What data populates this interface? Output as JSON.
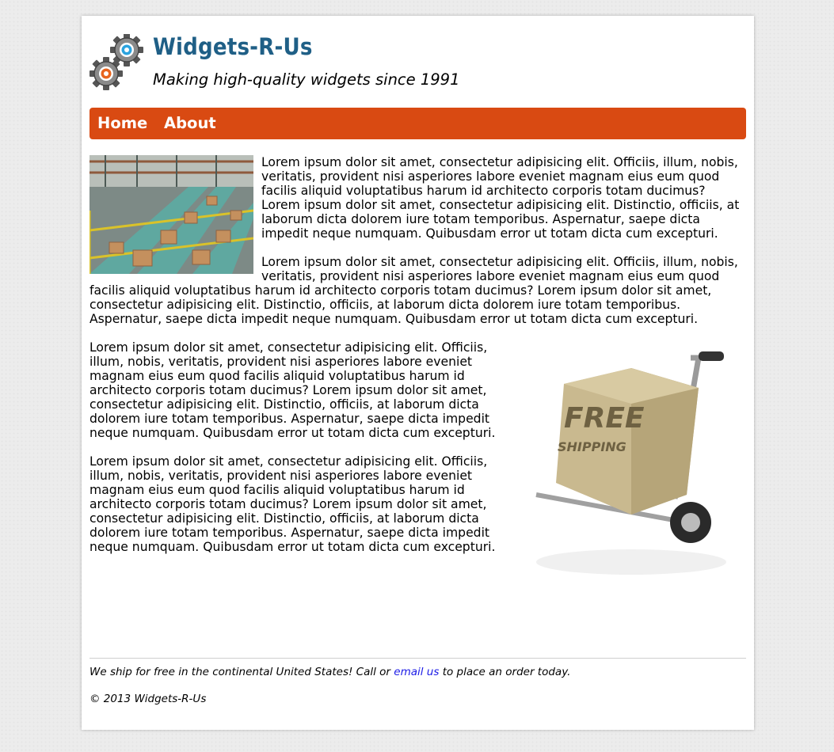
{
  "header": {
    "title": "Widgets-R-Us",
    "tagline": "Making high-quality widgets since 1991",
    "logo_icon": "gears-icon"
  },
  "nav": {
    "items": [
      {
        "label": "Home"
      },
      {
        "label": "About"
      }
    ],
    "color": "#d94a12"
  },
  "content": {
    "paragraphs": [
      "Lorem ipsum dolor sit amet, consectetur adipisicing elit. Officiis, illum, nobis, veritatis, provident nisi asperiores labore eveniet magnam eius eum quod facilis aliquid voluptatibus harum id architecto corporis totam ducimus? Lorem ipsum dolor sit amet, consectetur adipisicing elit. Distinctio, officiis, at laborum dicta dolorem iure totam temporibus. Aspernatur, saepe dicta impedit neque numquam. Quibusdam error ut totam dicta cum excepturi.",
      "Lorem ipsum dolor sit amet, consectetur adipisicing elit. Officiis, illum, nobis, veritatis, provident nisi asperiores labore eveniet magnam eius eum quod facilis aliquid voluptatibus harum id architecto corporis totam ducimus? Lorem ipsum dolor sit amet, consectetur adipisicing elit. Distinctio, officiis, at laborum dicta dolorem iure totam temporibus. Aspernatur, saepe dicta impedit neque numquam. Quibusdam error ut totam dicta cum excepturi.",
      "Lorem ipsum dolor sit amet, consectetur adipisicing elit. Officiis, illum, nobis, veritatis, provident nisi asperiores labore eveniet magnam eius eum quod facilis aliquid voluptatibus harum id architecto corporis totam ducimus? Lorem ipsum dolor sit amet, consectetur adipisicing elit. Distinctio, officiis, at laborum dicta dolorem iure totam temporibus. Aspernatur, saepe dicta impedit neque numquam. Quibusdam error ut totam dicta cum excepturi.",
      "Lorem ipsum dolor sit amet, consectetur adipisicing elit. Officiis, illum, nobis, veritatis, provident nisi asperiores labore eveniet magnam eius eum quod facilis aliquid voluptatibus harum id architecto corporis totam ducimus? Lorem ipsum dolor sit amet, consectetur adipisicing elit. Distinctio, officiis, at laborum dicta dolorem iure totam temporibus. Aspernatur, saepe dicta impedit neque numquam. Quibusdam error ut totam dicta cum excepturi."
    ],
    "images": {
      "warehouse": {
        "alt": "warehouse-conveyor-image"
      },
      "shipping": {
        "box_line1": "FREE",
        "box_line2": "SHIPPING"
      }
    }
  },
  "footer": {
    "ship_before": "We ship for free in the continental United States! Call or ",
    "email_link": "email us",
    "ship_after": " to place an order today.",
    "copyright": "© 2013 Widgets-R-Us"
  }
}
